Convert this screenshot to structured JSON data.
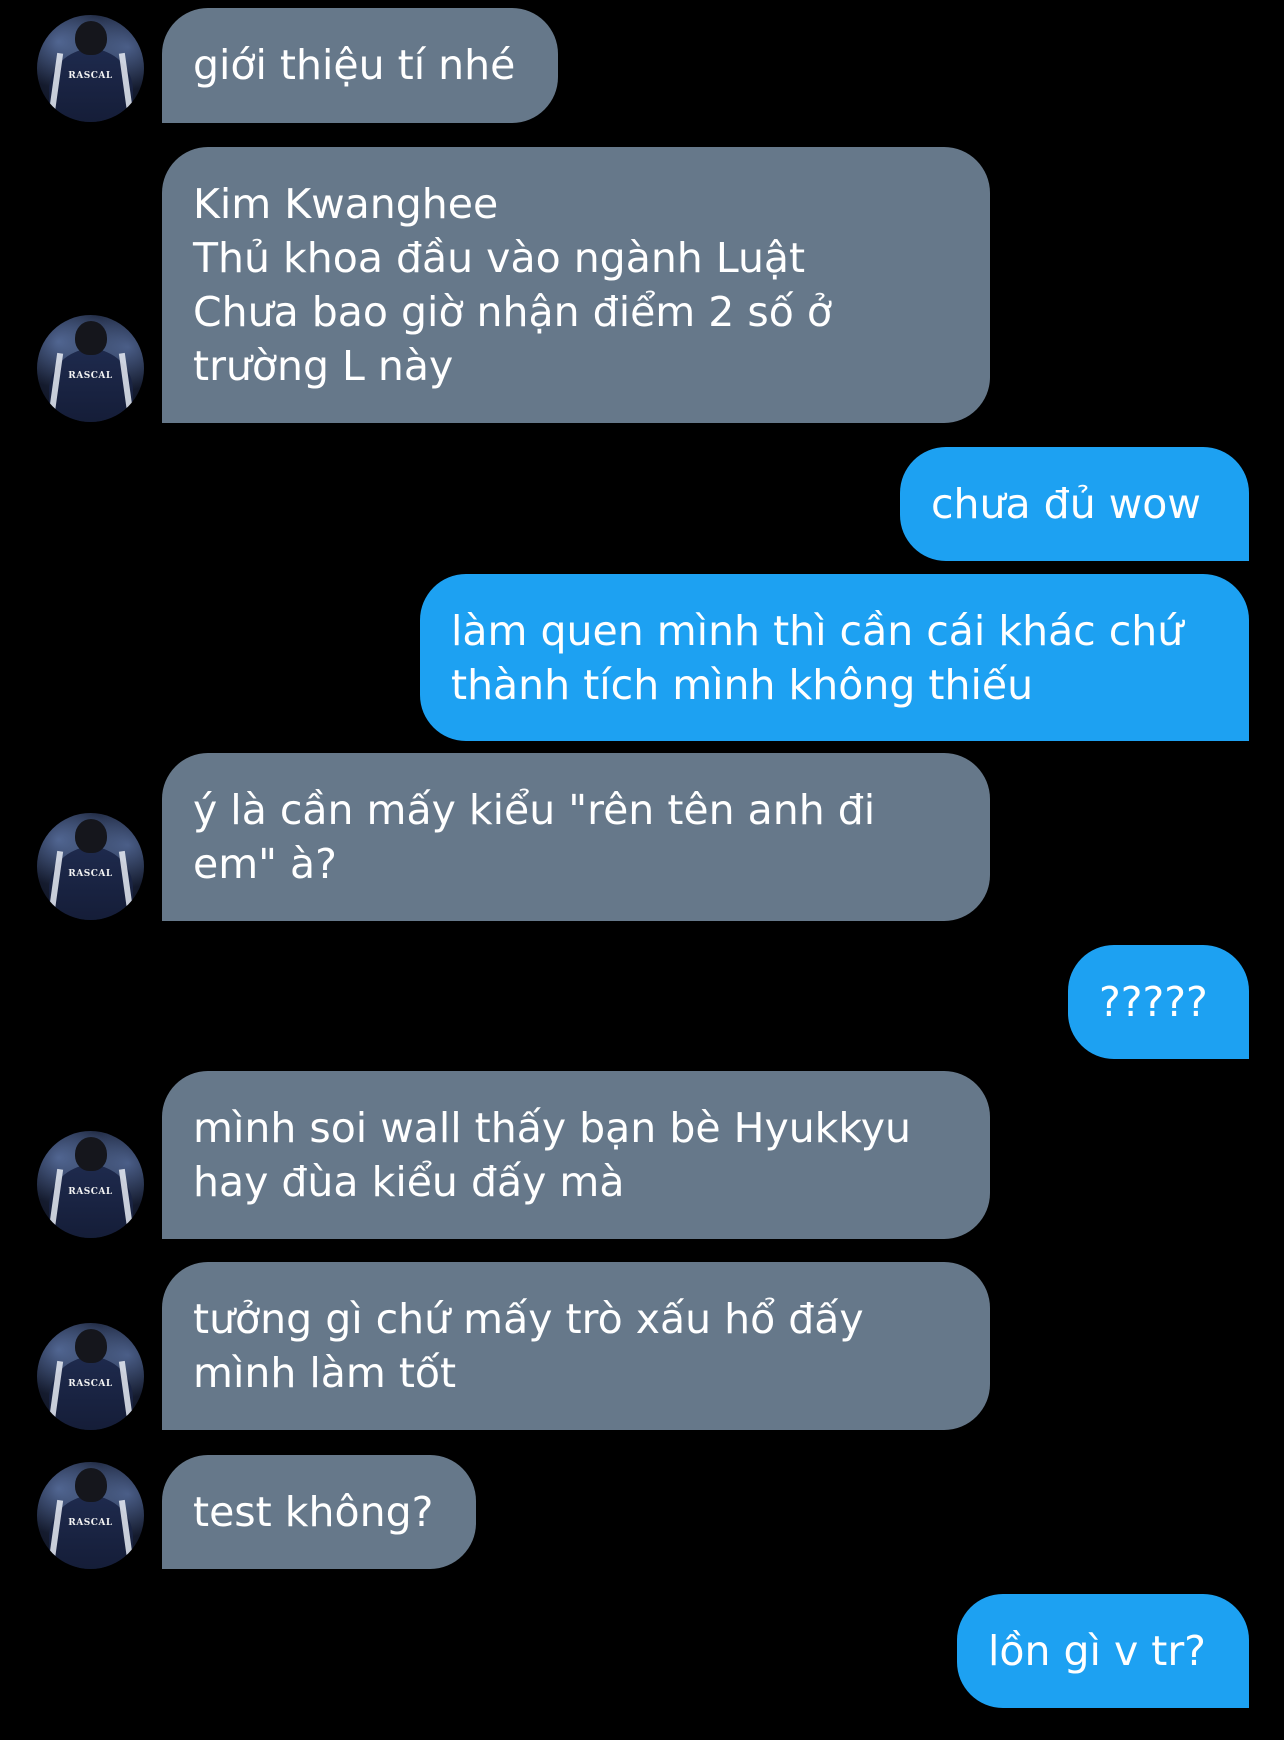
{
  "avatar": {
    "logo_text": "RASCAL"
  },
  "messages": [
    {
      "side": "in",
      "text": "giới thiệu tí nhé"
    },
    {
      "side": "in",
      "text": "Kim Kwanghee\nThủ khoa đầu vào ngành Luật\nChưa bao giờ nhận điểm 2 số ở\ntrường L này"
    },
    {
      "side": "out",
      "text": "chưa đủ wow"
    },
    {
      "side": "out",
      "text": "làm quen mình thì cần cái khác chứ\nthành tích mình không thiếu"
    },
    {
      "side": "in",
      "text": "ý là cần mấy kiểu \"rên tên anh đi\nem\" à?"
    },
    {
      "side": "out",
      "text": "?????"
    },
    {
      "side": "in",
      "text": "mình soi wall thấy bạn bè Hyukkyu\nhay đùa kiểu đấy mà"
    },
    {
      "side": "in",
      "text": "tưởng gì chứ mấy trò xấu hổ đấy\nmình làm tốt"
    },
    {
      "side": "in",
      "text": "test không?"
    },
    {
      "side": "out",
      "text": "lồn gì v tr?"
    }
  ],
  "colors": {
    "background": "#000000",
    "incoming_bubble": "#66788a",
    "outgoing_bubble": "#1da1f2",
    "text": "#ffffff"
  }
}
